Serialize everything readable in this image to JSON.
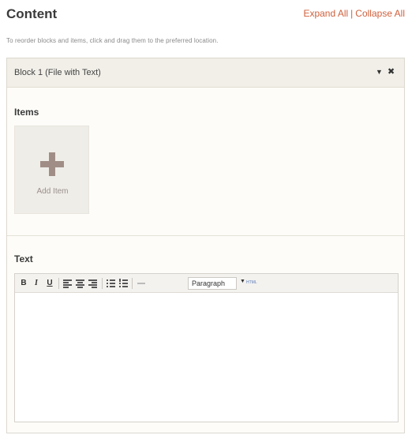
{
  "header": {
    "title": "Content",
    "expand_all": "Expand All",
    "separator": "|",
    "collapse_all": "Collapse All"
  },
  "hint": "To reorder blocks and items, click and drag them to the preferred location.",
  "block": {
    "title": "Block 1 (File with Text)",
    "collapse_glyph": "▼",
    "close_glyph": "✖",
    "items_title": "Items",
    "add_item_label": "Add Item",
    "text_title": "Text"
  },
  "editor": {
    "bold": "B",
    "italic": "I",
    "underline": "U",
    "format_select": "Paragraph",
    "dropdown_glyph": "▼",
    "html_label": "HTML",
    "content": ""
  },
  "colors": {
    "link": "#d0603c",
    "plus_icon": "#a08e86",
    "block_header_bg": "#f1efe8"
  }
}
